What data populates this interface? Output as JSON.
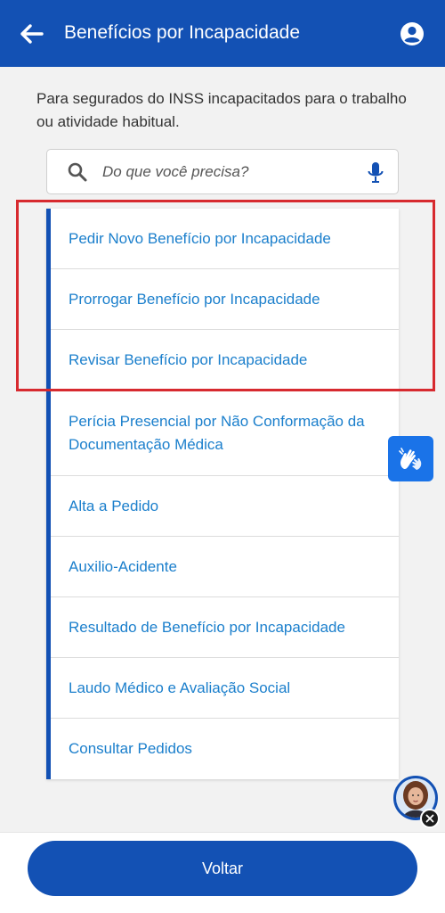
{
  "header": {
    "title": "Benefícios por Incapacidade",
    "back_icon": "arrow-left-icon",
    "account_icon": "account-circle-icon",
    "bg_color": "#1351b4"
  },
  "description": "Para segurados do INSS incapacitados para o trabalho ou atividade habitual.",
  "search": {
    "placeholder": "Do que você precisa?",
    "search_icon": "search-icon",
    "mic_icon": "microphone-icon"
  },
  "menu": {
    "items": [
      {
        "label": "Pedir Novo Benefício por Incapacidade"
      },
      {
        "label": "Prorrogar Benefício por Incapacidade"
      },
      {
        "label": "Revisar Benefício por Incapacidade"
      },
      {
        "label": "Perícia Presencial por Não Conformação da Documentação Médica"
      },
      {
        "label": "Alta a Pedido"
      },
      {
        "label": "Auxilio-Acidente"
      },
      {
        "label": "Resultado de Benefício por Incapacidade"
      },
      {
        "label": "Laudo Médico e Avaliação Social"
      },
      {
        "label": "Consultar Pedidos"
      }
    ],
    "accent_color": "#1351b4",
    "text_color": "#1b7fcc"
  },
  "highlight_color": "#d72a2f",
  "libras_icon": "sign-language-hands-icon",
  "assistant": {
    "avatar_icon": "assistant-avatar-icon",
    "close_icon": "close-icon"
  },
  "footer": {
    "back_label": "Voltar"
  }
}
